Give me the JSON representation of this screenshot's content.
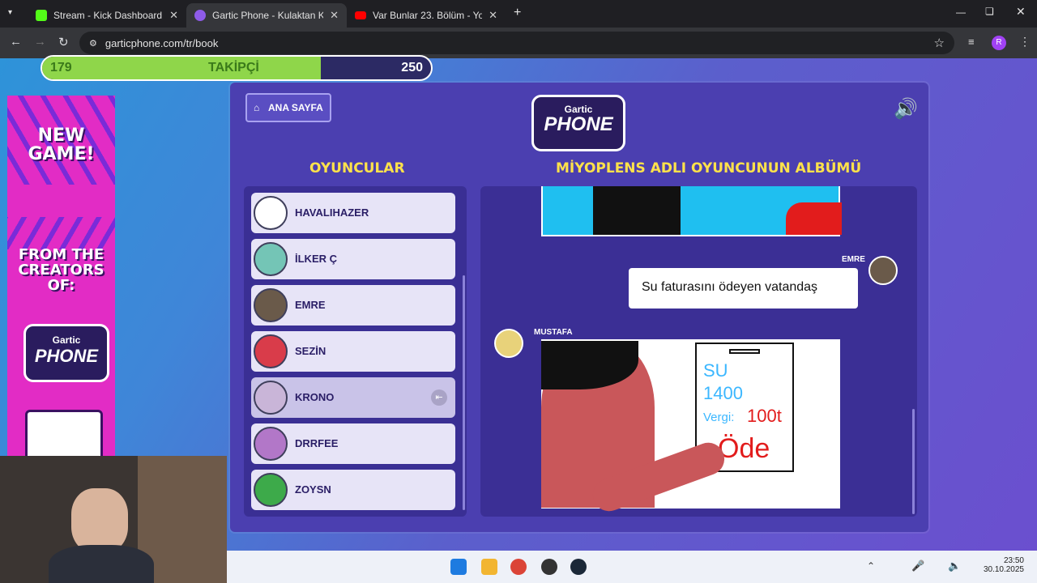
{
  "browser": {
    "tabs": [
      {
        "label": "Stream - Kick Dashboard",
        "favicon_color": "#53fc18",
        "active": false
      },
      {
        "label": "Gartic Phone - Kulaktan Kulağa",
        "favicon_color": "#8e5be8",
        "active": true
      },
      {
        "label": "Var Bunlar 23. Bölüm - YouTube",
        "favicon_color": "#ff0000",
        "active": false
      }
    ],
    "url": "garticphone.com/tr/book",
    "profile_initial": "R"
  },
  "follow_bar": {
    "current": "179",
    "label": "TAKİPÇİ",
    "goal": "250",
    "progress": 0.716
  },
  "ad": {
    "line1": "NEW GAME!",
    "line2": "FROM THE CREATORS OF:",
    "brand_top": "Gartic",
    "brand_bottom": "PHONE"
  },
  "game": {
    "home_label": "ANA SAYFA",
    "logo_top": "Gartic",
    "logo_bottom": "PHONE",
    "players_heading": "OYUNCULAR",
    "album_heading": "MİYOPLENS ADLI OYUNCUNUN ALBÜMÜ",
    "players": [
      {
        "name": "HAVALIHAZER",
        "avatar_color": "#ffffff"
      },
      {
        "name": "İLKER Ç",
        "avatar_color": "#74c5b6"
      },
      {
        "name": "EMRE",
        "avatar_color": "#6a5a4a"
      },
      {
        "name": "SEZİN",
        "avatar_color": "#d93c4a"
      },
      {
        "name": "KRONO",
        "avatar_color": "#c9b5d8",
        "selected": true
      },
      {
        "name": "DRRFEE",
        "avatar_color": "#b277c8"
      },
      {
        "name": "ZOYSN",
        "avatar_color": "#3daa4a"
      }
    ],
    "entries": [
      {
        "author": "EMRE",
        "text": "Su faturasını ödeyen vatandaş"
      },
      {
        "author": "MUSTAFA",
        "drawing_text_1": "SU",
        "drawing_text_2": "1400",
        "drawing_text_3": "Vergi:",
        "drawing_text_4": "100t",
        "drawing_text_5": "Öde"
      }
    ]
  },
  "taskbar": {
    "time": "23:50",
    "date": "30.10.2025"
  }
}
